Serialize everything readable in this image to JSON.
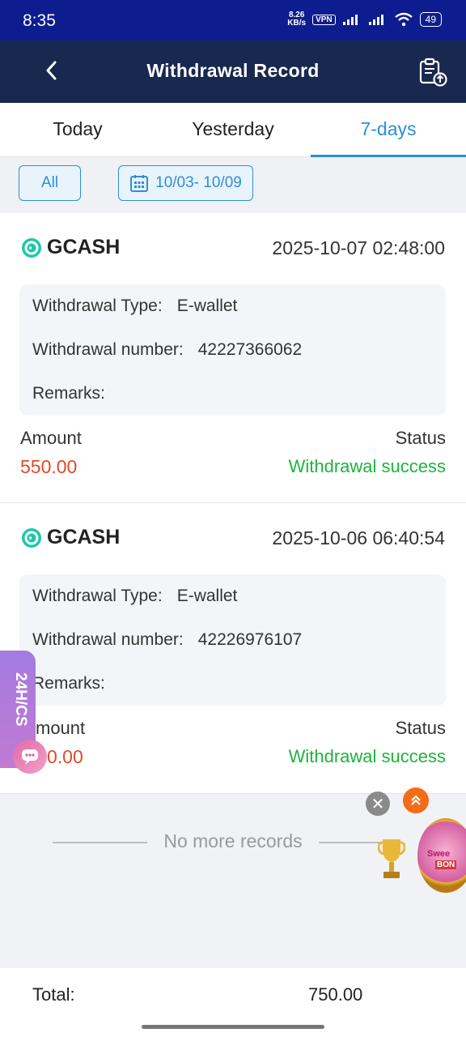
{
  "status_bar": {
    "time": "8:35",
    "speed_value": "8.26",
    "speed_unit": "KB/s",
    "vpn": "VPN",
    "battery": "49"
  },
  "header": {
    "title": "Withdrawal Record"
  },
  "tabs": [
    {
      "label": "Today",
      "active": false
    },
    {
      "label": "Yesterday",
      "active": false
    },
    {
      "label": "7-days",
      "active": true
    }
  ],
  "filters": {
    "all_label": "All",
    "date_range": "10/03- 10/09"
  },
  "records": [
    {
      "method": "GCASH",
      "datetime": "2025-10-07 02:48:00",
      "type_label": "Withdrawal Type:",
      "type_value": "E-wallet",
      "number_label": "Withdrawal number:",
      "number_value": "42227366062",
      "remarks_label": "Remarks:",
      "amount_label": "Amount",
      "amount_value": "550.00",
      "status_label": "Status",
      "status_value": "Withdrawal success"
    },
    {
      "method": "GCASH",
      "datetime": "2025-10-06 06:40:54",
      "type_label": "Withdrawal Type:",
      "type_value": "E-wallet",
      "number_label": "Withdrawal number:",
      "number_value": "42226976107",
      "remarks_label": "Remarks:",
      "amount_label": "mount",
      "amount_value": "0.00",
      "status_label": "Status",
      "status_value": "Withdrawal success"
    }
  ],
  "no_more_text": "No more records",
  "footer": {
    "total_label": "Total:",
    "total_value": "750.00"
  },
  "support": {
    "label": "24H/CS"
  },
  "promo": {
    "line1": "Swee",
    "line2": "BON"
  },
  "colors": {
    "accent": "#2c8fd6",
    "amount": "#e04a2a",
    "success": "#1db33c",
    "header_bg": "#19284e",
    "statusbar_bg": "#0d1d8f"
  },
  "icons": [
    "back-arrow-icon",
    "record-upload-icon",
    "calendar-icon",
    "gcash-icon",
    "chat-icon",
    "close-icon",
    "double-chevron-up-icon",
    "trophy-icon"
  ]
}
